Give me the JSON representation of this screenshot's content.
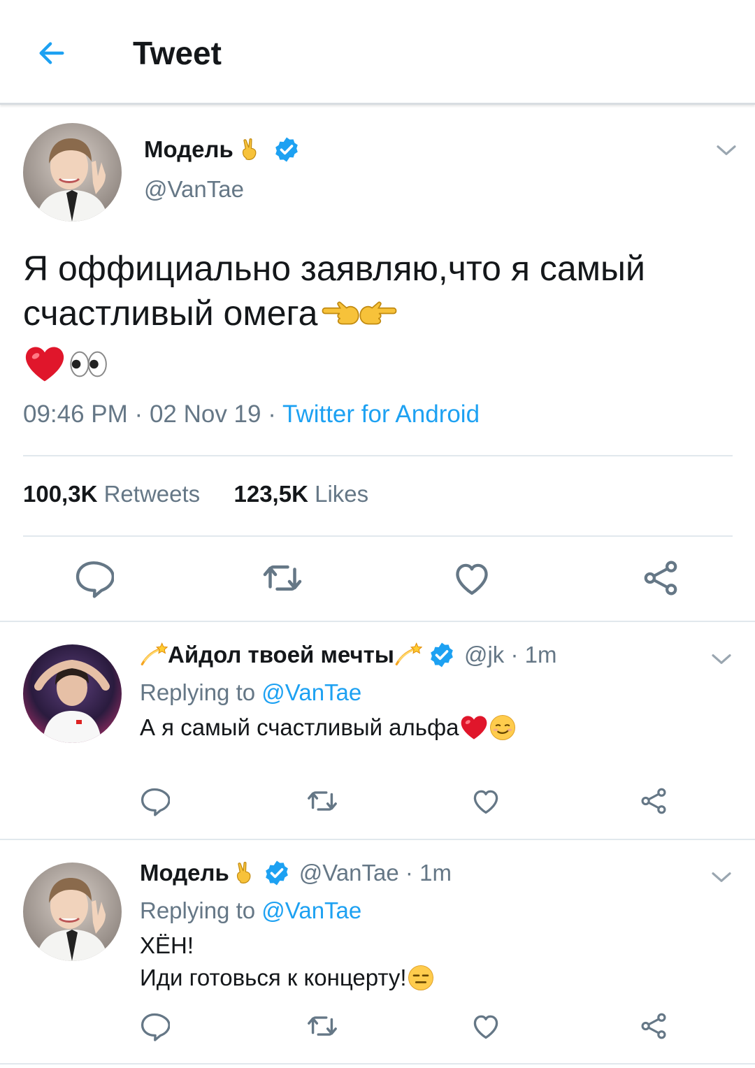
{
  "header": {
    "title": "Tweet",
    "back_icon": "arrow-left-icon",
    "accent": "#1da1f2"
  },
  "main_tweet": {
    "display_name": "Модель",
    "handle": "@VanTae",
    "text_line1": "Я оффициально заявляю,что я самый",
    "text_line2": "счастливый омега",
    "time": "09:46 PM",
    "date": "02 Nov 19",
    "source": "Twitter for Android",
    "retweets_count": "100,3K",
    "retweets_label": "Retweets",
    "likes_count": "123,5K",
    "likes_label": "Likes"
  },
  "replies": [
    {
      "display_name": "Айдол твоей мечты",
      "handle": "@jk",
      "time": "1m",
      "replying_prefix": "Replying to",
      "replying_to": "@VanTae",
      "text_line1": "А я самый счастливый альфа"
    },
    {
      "display_name": "Модель",
      "handle": "@VanTae",
      "time": "1m",
      "replying_prefix": "Replying to",
      "replying_to": "@VanTae",
      "text_line1": "ХЁН!",
      "text_line2": "Иди готовься к концерту!"
    }
  ],
  "separators": {
    "dot": "·"
  },
  "colors": {
    "text": "#14171a",
    "secondary": "#657786",
    "link": "#1da1f2",
    "divider": "#e1e8ed",
    "heart": "#e0245e"
  }
}
